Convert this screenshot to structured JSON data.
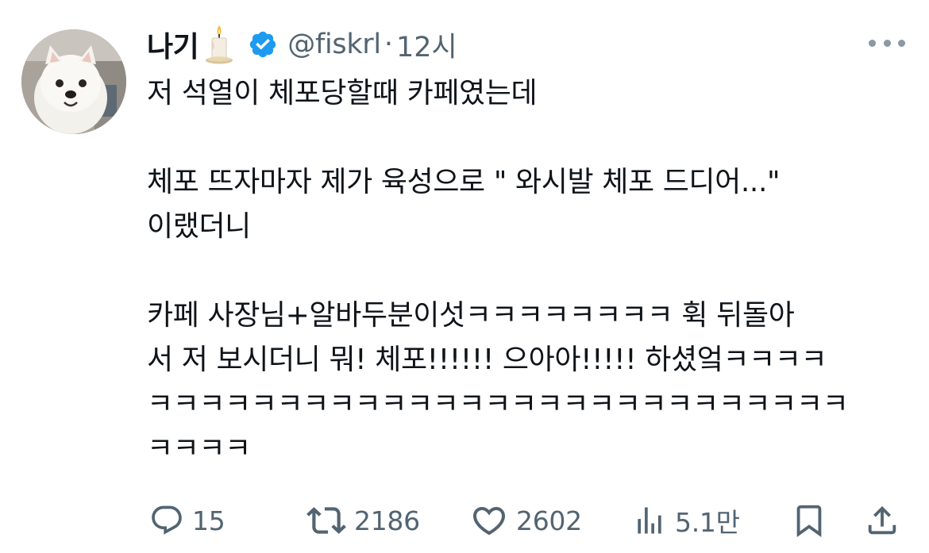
{
  "author": {
    "display_name": "나기",
    "handle": "@fiskrl",
    "separator": "·",
    "timestamp": "12시",
    "verified": true,
    "name_emoji_icon": "candle-icon"
  },
  "tweet": {
    "lines": [
      "저 석열이 체포당할때 카페였는데",
      "",
      "체포 뜨자마자 제가 육성으로 \" 와시발 체포 드디어...\"",
      "이랬더니",
      "",
      "카페 사장님+알바두분이섯ㅋㅋㅋㅋㅋㅋㅋㅋ 휙 뒤돌아",
      "서 저 보시더니 뭐! 체포!!!!!! 으아아!!!!! 하셨엌ㅋㅋㅋㅋ",
      "ㅋㅋㅋㅋㅋㅋㅋㅋㅋㅋㅋㅋㅋㅋㅋㅋㅋㅋㅋㅋㅋㅋㅋㅋㅋㅋㅋ",
      "ㅋㅋㅋㅋ"
    ]
  },
  "actions": {
    "reply": {
      "icon": "reply-icon",
      "count": "15"
    },
    "repost": {
      "icon": "repost-icon",
      "count": "2186"
    },
    "like": {
      "icon": "heart-icon",
      "count": "2602"
    },
    "views": {
      "icon": "analytics-icon",
      "count": "5.1만"
    },
    "bookmark": {
      "icon": "bookmark-icon"
    },
    "share": {
      "icon": "share-icon"
    }
  },
  "colors": {
    "text": "#0f1419",
    "secondary": "#536471",
    "verified": "#1d9bf0",
    "more_dots": "#8b98a5"
  }
}
